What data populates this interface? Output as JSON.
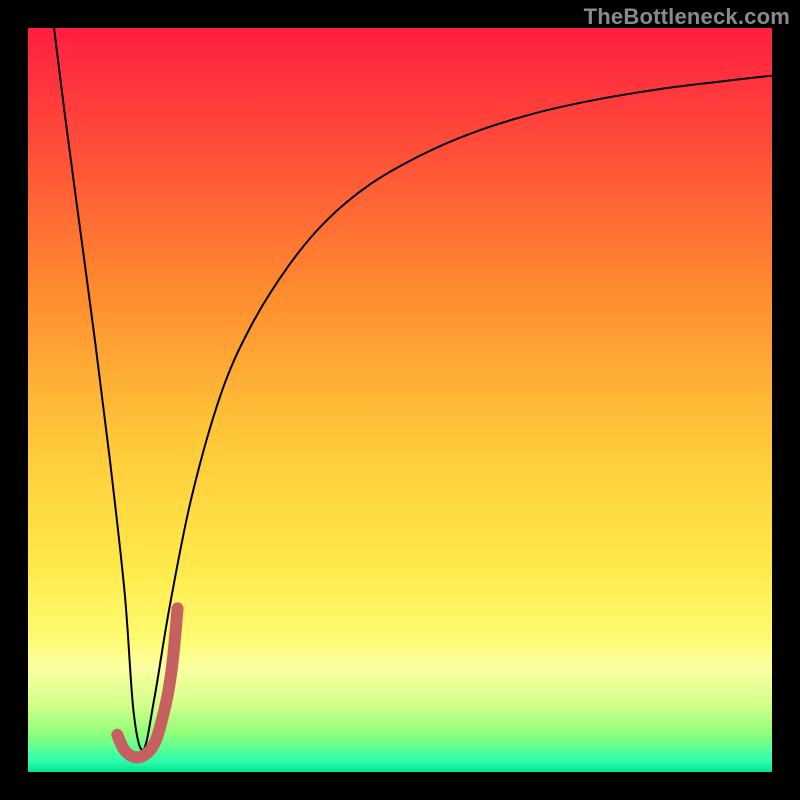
{
  "watermark": "TheBottleneck.com",
  "chart_data": {
    "type": "line",
    "title": "",
    "xlabel": "",
    "ylabel": "",
    "xlim": [
      0,
      100
    ],
    "ylim": [
      0,
      100
    ],
    "grid": false,
    "legend": false,
    "background_gradient": {
      "stops": [
        {
          "offset": 0.0,
          "color": "#ff1f3f"
        },
        {
          "offset": 0.15,
          "color": "#ff4a3a"
        },
        {
          "offset": 0.35,
          "color": "#ff8a2f"
        },
        {
          "offset": 0.55,
          "color": "#ffc739"
        },
        {
          "offset": 0.72,
          "color": "#ffe94a"
        },
        {
          "offset": 0.82,
          "color": "#fffb70"
        },
        {
          "offset": 0.86,
          "color": "#fbffa2"
        },
        {
          "offset": 0.91,
          "color": "#d2ff8a"
        },
        {
          "offset": 0.95,
          "color": "#8cff7a"
        },
        {
          "offset": 0.985,
          "color": "#2bffb0"
        },
        {
          "offset": 1.0,
          "color": "#04e38a"
        }
      ]
    },
    "series": [
      {
        "name": "bottleneck-curve",
        "stroke": "#000000",
        "stroke_width": 2,
        "x": [
          3.5,
          5,
          7,
          9,
          11,
          13,
          14.2,
          15.5,
          17,
          19,
          22,
          26,
          30,
          35,
          40,
          46,
          53,
          60,
          68,
          76,
          85,
          93,
          100
        ],
        "y": [
          100,
          88,
          73,
          58,
          42,
          24,
          8,
          3,
          10,
          22,
          37,
          51,
          60,
          68,
          74,
          79,
          83,
          86,
          88.5,
          90.3,
          91.8,
          92.8,
          93.6
        ]
      },
      {
        "name": "j-mark",
        "stroke": "#c76060",
        "stroke_width": 12,
        "stroke_linecap": "round",
        "x": [
          12.0,
          12.8,
          13.8,
          15.0,
          16.2,
          17.2,
          18.0,
          18.8,
          19.4,
          19.8,
          20.1
        ],
        "y": [
          5.0,
          3.2,
          2.2,
          2.0,
          2.7,
          4.3,
          7.0,
          10.5,
          14.5,
          18.5,
          22.0
        ]
      }
    ]
  }
}
